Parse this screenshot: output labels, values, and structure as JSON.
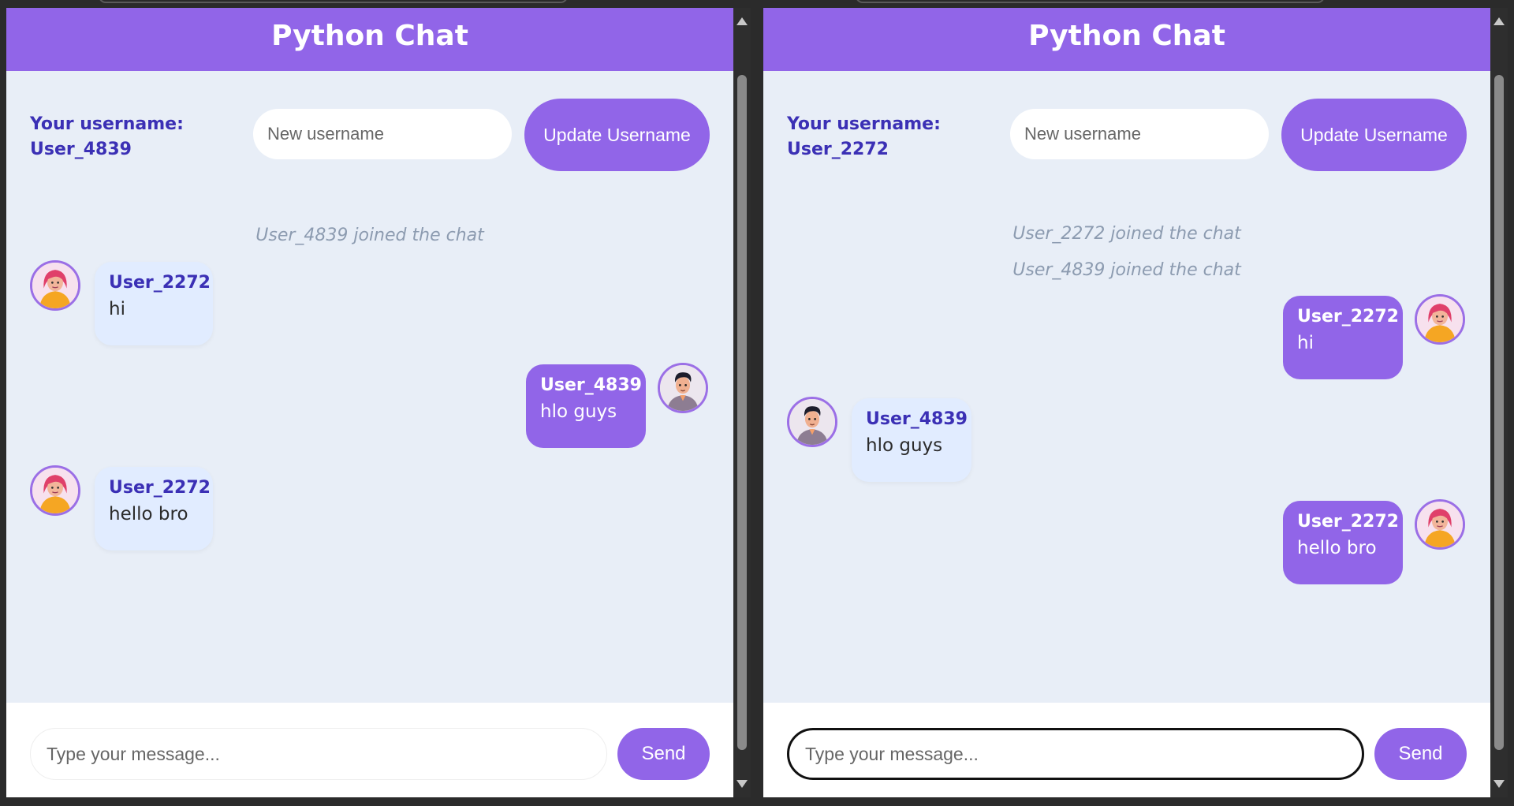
{
  "left": {
    "title": "Python Chat",
    "your_username_label": "Your username:",
    "your_username": "User_4839",
    "username_placeholder": "New username",
    "update_button": "Update Username",
    "system_messages": [
      "User_4839 joined the chat"
    ],
    "messages": [
      {
        "sender": "User_2272",
        "text": "hi",
        "side": "incoming",
        "avatar": "woman-avatar"
      },
      {
        "sender": "User_4839",
        "text": "hlo guys",
        "side": "outgoing",
        "avatar": "man-avatar"
      },
      {
        "sender": "User_2272",
        "text": "hello bro",
        "side": "incoming",
        "avatar": "woman-avatar"
      }
    ],
    "message_placeholder": "Type your message...",
    "send_button": "Send"
  },
  "right": {
    "title": "Python Chat",
    "your_username_label": "Your username:",
    "your_username": "User_2272",
    "username_placeholder": "New username",
    "update_button": "Update Username",
    "system_messages": [
      "User_2272 joined the chat",
      "User_4839 joined the chat"
    ],
    "messages": [
      {
        "sender": "User_2272",
        "text": "hi",
        "side": "outgoing",
        "avatar": "woman-avatar"
      },
      {
        "sender": "User_4839",
        "text": "hlo guys",
        "side": "incoming",
        "avatar": "man-avatar"
      },
      {
        "sender": "User_2272",
        "text": "hello bro",
        "side": "outgoing",
        "avatar": "woman-avatar"
      }
    ],
    "message_placeholder": "Type your message...",
    "send_button": "Send"
  },
  "colors": {
    "accent": "#9165e8",
    "background": "#e8eef7",
    "username_text": "#3b30b5",
    "incoming_bubble": "#e1ecff",
    "system_text": "#8c9bb0"
  }
}
